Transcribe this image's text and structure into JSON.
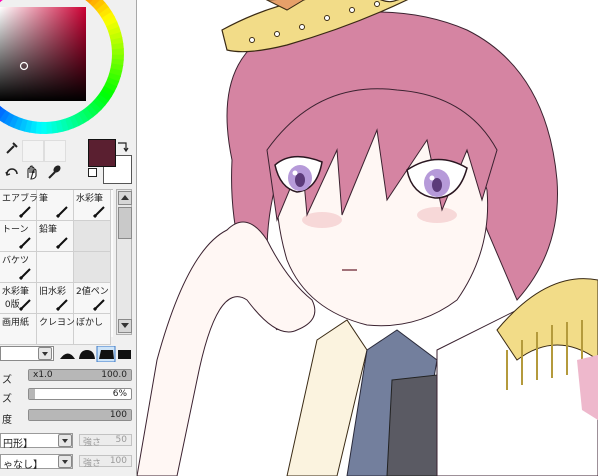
{
  "colors": {
    "main": "#5a1f30",
    "sub": "#ffffff",
    "accent": "#1f1f1f"
  },
  "tools": [
    {
      "label": "エアブラシ",
      "icon": "airbrush-icon"
    },
    {
      "label": "筆",
      "icon": "brush-icon"
    },
    {
      "label": "水彩筆",
      "icon": "watercolor-icon"
    },
    {
      "label": "トーン",
      "icon": "tone-icon"
    },
    {
      "label": "鉛筆",
      "icon": "pencil-icon"
    },
    {
      "label": "",
      "icon": ""
    },
    {
      "label": "バケツ",
      "icon": "bucket-icon"
    },
    {
      "label": "",
      "icon": ""
    },
    {
      "label": "",
      "icon": ""
    },
    {
      "label": "水彩筆\n 0版",
      "icon": "watercolor2-icon"
    },
    {
      "label": "旧水彩",
      "icon": "old-watercolor-icon"
    },
    {
      "label": "2値ペン",
      "icon": "binary-pen-icon"
    },
    {
      "label": "画用紙",
      "icon": ""
    },
    {
      "label": "クレヨン",
      "icon": ""
    },
    {
      "label": "ぼかし",
      "icon": ""
    }
  ],
  "brush": {
    "size_label": "ズ",
    "size_multiplier": "x1.0",
    "size_value": "100.0",
    "size_fill": 1.0,
    "min_size_label": "ズ",
    "min_size_value": "6%",
    "min_size_fill": 0.06,
    "density_label": "度",
    "density_value": "100",
    "density_fill": 1.0,
    "shape_label": "円形】",
    "shape_strength_label": "強さ",
    "shape_strength_value": "50",
    "texture_label": "ゃなし】",
    "texture_strength_label": "強さ",
    "texture_strength_value": "100"
  }
}
